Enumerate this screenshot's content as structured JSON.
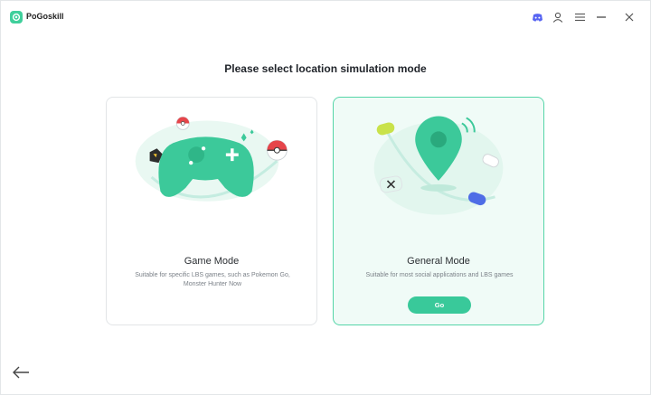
{
  "app": {
    "name": "PoGoskill"
  },
  "title_bar": {
    "icons": [
      "discord-icon",
      "user-icon",
      "menu-icon",
      "minimize-icon",
      "close-icon"
    ]
  },
  "page": {
    "heading": "Please select location simulation mode"
  },
  "modes": [
    {
      "title": "Game Mode",
      "description": "Suitable for specific LBS games, such as Pokemon Go, Monster Hunter Now",
      "selected": false
    },
    {
      "title": "General Mode",
      "description": "Suitable for most social applications and LBS games",
      "button_label": "Go",
      "selected": true
    }
  ],
  "colors": {
    "accent": "#39c99a",
    "selected_border": "#55d5a8",
    "selected_bg": "#f0fbf7",
    "text_primary": "#1f2329",
    "text_secondary": "#7b8188"
  }
}
